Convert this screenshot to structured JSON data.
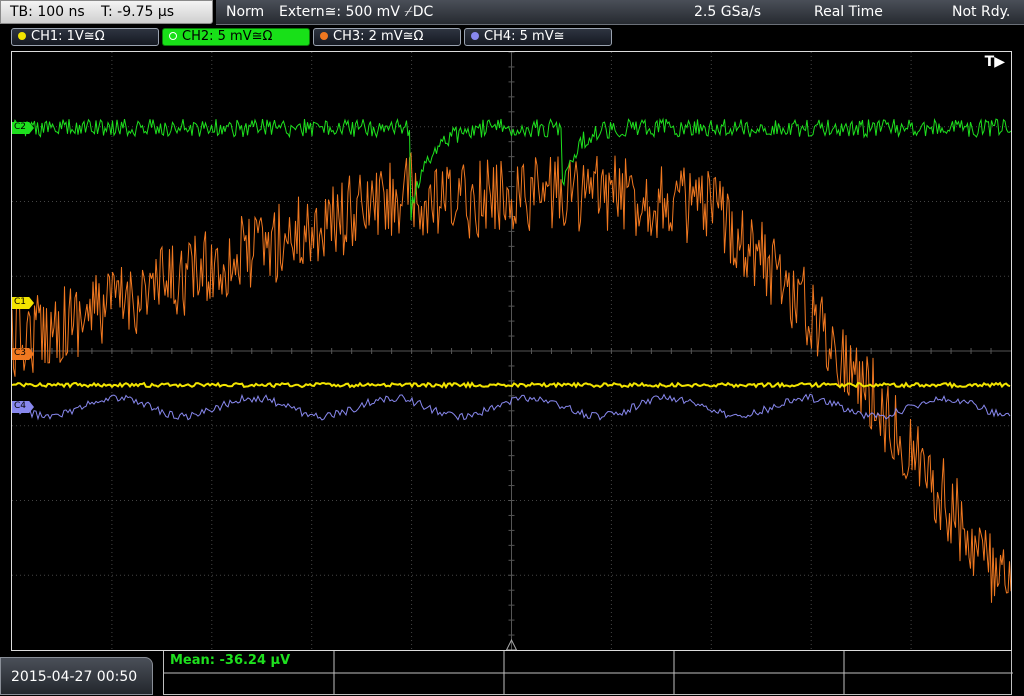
{
  "topbar": {
    "timebase": "TB: 100 ns",
    "trigger_time": "T: -9.75 µs",
    "mode": "Norm",
    "trigger_source": "Extern≅: 500 mV ⌿DC",
    "sample_rate": "2.5 GSa/s",
    "acq_mode": "Real Time",
    "run_state": "Not Rdy."
  },
  "channels": [
    {
      "id": "ch1",
      "label": "CH1: 1V≅Ω",
      "color": "#f2e400",
      "active": false
    },
    {
      "id": "ch2",
      "label": "CH2: 5 mV≅Ω",
      "color": "#1ee01e",
      "active": true
    },
    {
      "id": "ch3",
      "label": "CH3: 2 mV≅Ω",
      "color": "#f07820",
      "active": false
    },
    {
      "id": "ch4",
      "label": "CH4: 5 mV≅",
      "color": "#8888ee",
      "active": false
    }
  ],
  "markers": [
    {
      "id": "c2",
      "label": "C2",
      "color": "#1ee01e"
    },
    {
      "id": "c1",
      "label": "C1",
      "color": "#f2e400"
    },
    {
      "id": "c3",
      "label": "C3",
      "color": "#f07820"
    },
    {
      "id": "c4",
      "label": "C4",
      "color": "#8888ee"
    }
  ],
  "trigger_indicator": "T▶",
  "colors": {
    "ch1": "#f2e400",
    "ch2": "#1ee01e",
    "ch3": "#f07820",
    "ch4": "#8888ee",
    "grid": "#444444"
  },
  "bottom": {
    "datetime": "2015-04-27  00:50",
    "measurement": "Mean: -36.24 µV"
  }
}
